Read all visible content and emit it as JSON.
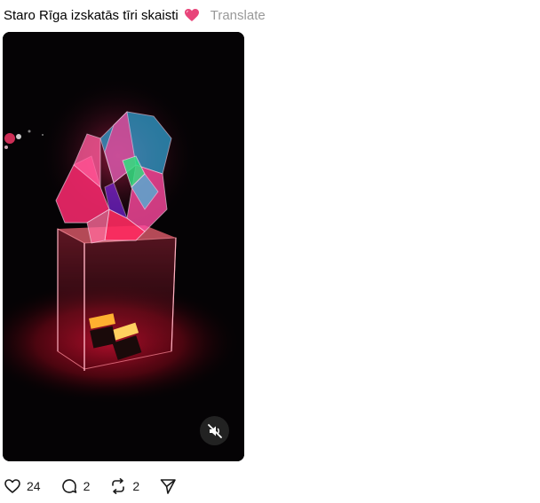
{
  "post": {
    "caption": "Staro Rīga izskatās tīri skaisti",
    "caption_emoji": "heart-icon",
    "translate_label": "Translate"
  },
  "media": {
    "type": "video",
    "muted": true,
    "mute_icon": "speaker-muted-icon"
  },
  "actions": {
    "like_count": "24",
    "comment_count": "2",
    "repost_count": "2",
    "icons": [
      "heart-outline-icon",
      "comment-icon",
      "repost-icon",
      "share-icon"
    ]
  },
  "colors": {
    "accent_heart": "#e8457a",
    "muted_text": "#999999"
  }
}
